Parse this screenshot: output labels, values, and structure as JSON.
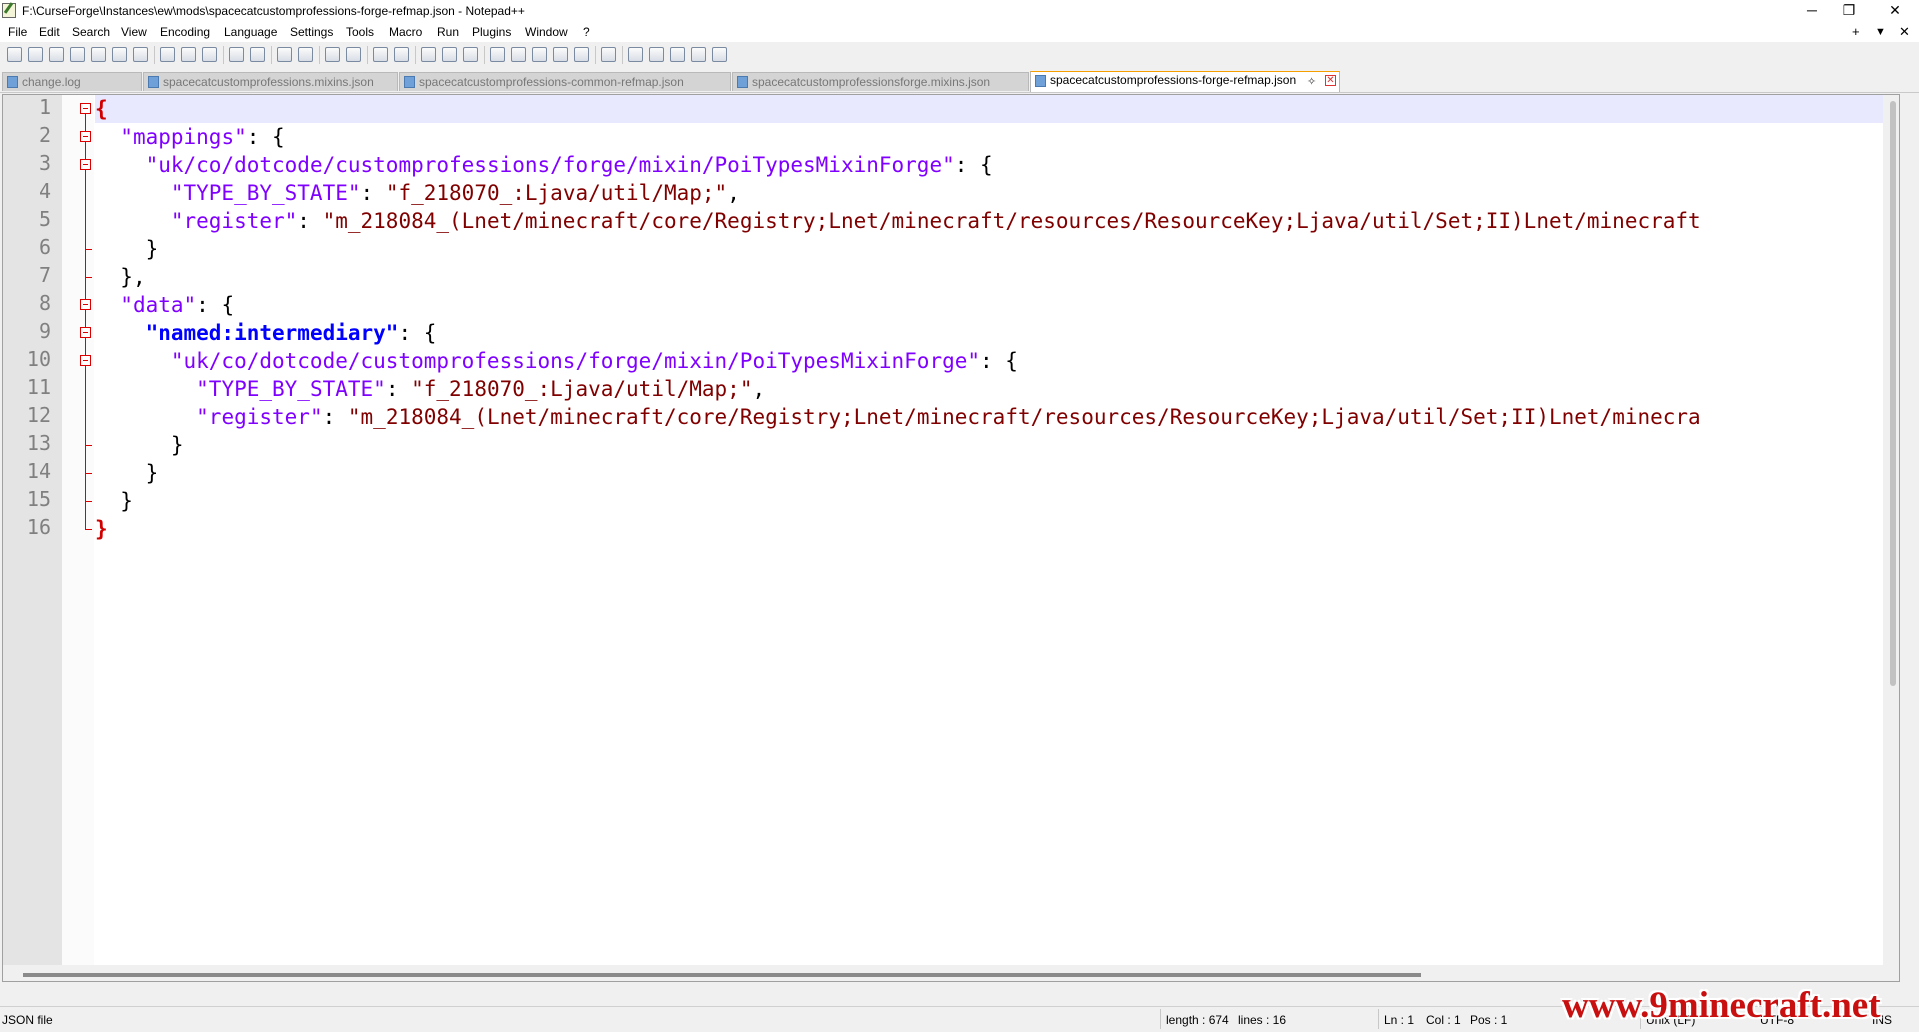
{
  "window": {
    "title": "F:\\CurseForge\\Instances\\ew\\mods\\spacecatcustomprofessions-forge-refmap.json - Notepad++",
    "minimize": "─",
    "maximize": "❐",
    "close": "✕"
  },
  "menu": {
    "items": [
      "File",
      "Edit",
      "Search",
      "View",
      "Encoding",
      "Language",
      "Settings",
      "Tools",
      "Macro",
      "Run",
      "Plugins",
      "Window",
      "?"
    ],
    "right_plus": "+",
    "right_down": "▼",
    "right_close": "✕"
  },
  "tabs": [
    {
      "label": "change.log",
      "active": false
    },
    {
      "label": "spacecatcustomprofessions.mixins.json",
      "active": false
    },
    {
      "label": "spacecatcustomprofessions-common-refmap.json",
      "active": false
    },
    {
      "label": "spacecatcustomprofessionsforge.mixins.json",
      "active": false
    },
    {
      "label": "spacecatcustomprofessions-forge-refmap.json",
      "active": true
    }
  ],
  "editor": {
    "line_numbers": [
      "1",
      "2",
      "3",
      "4",
      "5",
      "6",
      "7",
      "8",
      "9",
      "10",
      "11",
      "12",
      "13",
      "14",
      "15",
      "16"
    ],
    "lines": [
      {
        "indent": "",
        "parts": [
          {
            "t": "{",
            "c": "b"
          }
        ]
      },
      {
        "indent": "  ",
        "parts": [
          {
            "t": "\"mappings\"",
            "c": "k"
          },
          {
            "t": ": {",
            "c": "p"
          }
        ]
      },
      {
        "indent": "    ",
        "parts": [
          {
            "t": "\"uk/co/dotcode/customprofessions/forge/mixin/PoiTypesMixinForge\"",
            "c": "k"
          },
          {
            "t": ": {",
            "c": "p"
          }
        ]
      },
      {
        "indent": "      ",
        "parts": [
          {
            "t": "\"TYPE_BY_STATE\"",
            "c": "k"
          },
          {
            "t": ": ",
            "c": "p"
          },
          {
            "t": "\"f_218070_:Ljava/util/Map;\"",
            "c": "s"
          },
          {
            "t": ",",
            "c": "p"
          }
        ]
      },
      {
        "indent": "      ",
        "parts": [
          {
            "t": "\"register\"",
            "c": "k"
          },
          {
            "t": ": ",
            "c": "p"
          },
          {
            "t": "\"m_218084_(Lnet/minecraft/core/Registry;Lnet/minecraft/resources/ResourceKey;Ljava/util/Set;II)Lnet/minecraft",
            "c": "s"
          }
        ]
      },
      {
        "indent": "    ",
        "parts": [
          {
            "t": "}",
            "c": "p"
          }
        ]
      },
      {
        "indent": "  ",
        "parts": [
          {
            "t": "},",
            "c": "p"
          }
        ]
      },
      {
        "indent": "  ",
        "parts": [
          {
            "t": "\"data\"",
            "c": "k"
          },
          {
            "t": ": {",
            "c": "p"
          }
        ]
      },
      {
        "indent": "    ",
        "parts": [
          {
            "t": "\"named:intermediary\"",
            "c": "n"
          },
          {
            "t": ": {",
            "c": "p"
          }
        ]
      },
      {
        "indent": "      ",
        "parts": [
          {
            "t": "\"uk/co/dotcode/customprofessions/forge/mixin/PoiTypesMixinForge\"",
            "c": "k"
          },
          {
            "t": ": {",
            "c": "p"
          }
        ]
      },
      {
        "indent": "        ",
        "parts": [
          {
            "t": "\"TYPE_BY_STATE\"",
            "c": "k"
          },
          {
            "t": ": ",
            "c": "p"
          },
          {
            "t": "\"f_218070_:Ljava/util/Map;\"",
            "c": "s"
          },
          {
            "t": ",",
            "c": "p"
          }
        ]
      },
      {
        "indent": "        ",
        "parts": [
          {
            "t": "\"register\"",
            "c": "k"
          },
          {
            "t": ": ",
            "c": "p"
          },
          {
            "t": "\"m_218084_(Lnet/minecraft/core/Registry;Lnet/minecraft/resources/ResourceKey;Ljava/util/Set;II)Lnet/minecra",
            "c": "s"
          }
        ]
      },
      {
        "indent": "      ",
        "parts": [
          {
            "t": "}",
            "c": "p"
          }
        ]
      },
      {
        "indent": "    ",
        "parts": [
          {
            "t": "}",
            "c": "p"
          }
        ]
      },
      {
        "indent": "  ",
        "parts": [
          {
            "t": "}",
            "c": "p"
          }
        ]
      },
      {
        "indent": "",
        "parts": [
          {
            "t": "}",
            "c": "b"
          }
        ]
      }
    ]
  },
  "status": {
    "file_type": "JSON file",
    "length": "length : 674",
    "lines": "lines : 16",
    "ln": "Ln : 1",
    "col": "Col : 1",
    "pos": "Pos : 1",
    "eol": "Unix (LF)",
    "encoding": "UTF-8",
    "mode": "INS"
  },
  "watermark": "www.9minecraft.net",
  "colors": {
    "keyword": "#8000ff",
    "string": "#800000",
    "brace": "#d00000",
    "named": "#0000ff",
    "active_tab_accent": "#f5a000"
  }
}
